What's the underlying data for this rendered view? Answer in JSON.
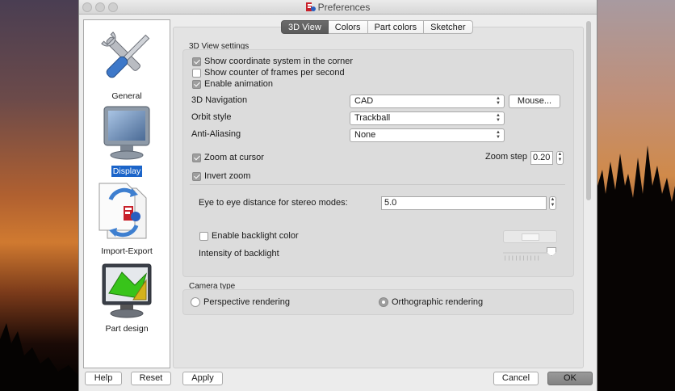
{
  "window": {
    "title": "Preferences"
  },
  "sidebar": {
    "items": [
      {
        "label": "General",
        "icon": "tools-icon",
        "selected": false
      },
      {
        "label": "Display",
        "icon": "monitor-icon",
        "selected": true
      },
      {
        "label": "Import-Export",
        "icon": "import-export-icon",
        "selected": false
      },
      {
        "label": "Part design",
        "icon": "part-design-icon",
        "selected": false
      }
    ]
  },
  "tabs": [
    {
      "label": "3D View",
      "active": true
    },
    {
      "label": "Colors",
      "active": false
    },
    {
      "label": "Part colors",
      "active": false
    },
    {
      "label": "Sketcher",
      "active": false
    }
  ],
  "view3d": {
    "group_title": "3D View settings",
    "show_coord": {
      "label": "Show coordinate system in the corner",
      "checked": true
    },
    "show_fps": {
      "label": "Show counter of frames per second",
      "checked": false
    },
    "enable_anim": {
      "label": "Enable animation",
      "checked": true
    },
    "navigation": {
      "label": "3D Navigation",
      "value": "CAD",
      "mouse_button": "Mouse..."
    },
    "orbit": {
      "label": "Orbit style",
      "value": "Trackball"
    },
    "antialias": {
      "label": "Anti-Aliasing",
      "value": "None"
    },
    "zoom_cursor": {
      "label": "Zoom at cursor",
      "checked": true
    },
    "zoom_step": {
      "label": "Zoom step",
      "value": "0.20"
    },
    "invert_zoom": {
      "label": "Invert zoom",
      "checked": true
    },
    "eye_distance": {
      "label": "Eye to eye distance for stereo modes:",
      "value": "5.0"
    },
    "backlight": {
      "label": "Enable backlight color",
      "checked": false
    },
    "backlight_intensity": {
      "label": "Intensity of backlight",
      "level": 1.0
    }
  },
  "camera": {
    "group_title": "Camera type",
    "perspective": {
      "label": "Perspective rendering",
      "selected": false
    },
    "orthographic": {
      "label": "Orthographic rendering",
      "selected": true
    }
  },
  "buttons": {
    "help": "Help",
    "reset": "Reset",
    "apply": "Apply",
    "cancel": "Cancel",
    "ok": "OK"
  }
}
